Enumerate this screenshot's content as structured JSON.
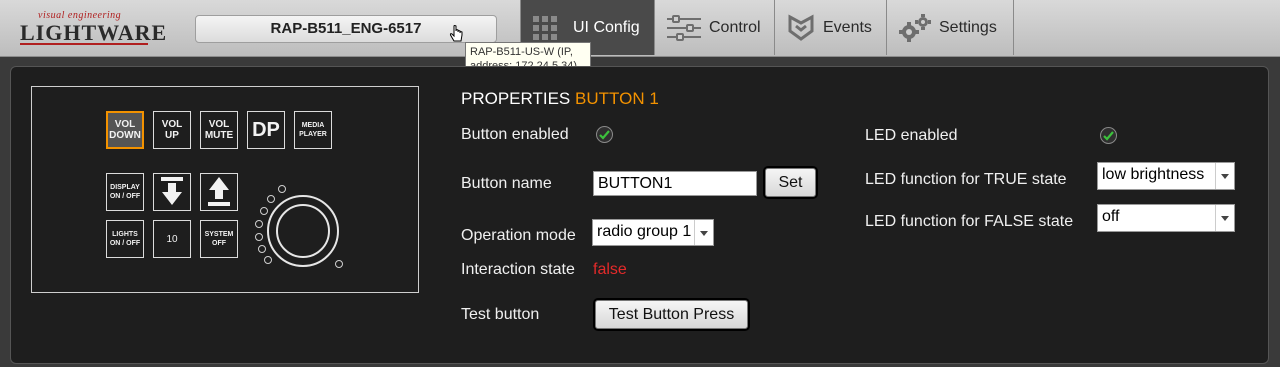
{
  "app": {
    "logo_tagline": "visual engineering",
    "logo_name": "LIGHTWARE",
    "device_name": "RAP-B511_ENG-6517",
    "tooltip": "RAP-B511-US-W (IP, address: 172.24.5.34)"
  },
  "tabs": [
    {
      "label": "UI Config",
      "icon": "grid-icon",
      "active": true
    },
    {
      "label": "Control",
      "icon": "sliders-icon",
      "active": false
    },
    {
      "label": "Events",
      "icon": "events-icon",
      "active": false
    },
    {
      "label": "Settings",
      "icon": "gear-icon",
      "active": false
    }
  ],
  "panel_buttons": {
    "vol_down": "VOL DOWN",
    "vol_up": "VOL UP",
    "vol_mute": "VOL MUTE",
    "dp": "DP",
    "media_player": "MEDIA PLAYER",
    "display_onoff": "DISPLAY ON / OFF",
    "down_arrow": "down-arrow-icon",
    "up_arrow": "up-arrow-icon",
    "lights_onoff": "LIGHTS ON / OFF",
    "ten": "10",
    "system_off": "SYSTEM OFF"
  },
  "properties": {
    "title": "PROPERTIES",
    "selected": "BUTTON 1",
    "button_enabled_label": "Button enabled",
    "button_enabled": true,
    "button_name_label": "Button name",
    "button_name_value": "BUTTON1",
    "set_label": "Set",
    "operation_mode_label": "Operation mode",
    "operation_mode_value": "radio group 1",
    "interaction_state_label": "Interaction state",
    "interaction_state_value": "false",
    "test_button_label": "Test button",
    "test_button_press": "Test Button Press",
    "led_enabled_label": "LED enabled",
    "led_enabled": true,
    "led_true_label": "LED function for TRUE state",
    "led_true_value": "low brightness",
    "led_false_label": "LED function for FALSE state",
    "led_false_value": "off"
  },
  "colors": {
    "accent": "#f39200",
    "false_red": "#e32a2a",
    "check_green": "#3cc23c"
  }
}
